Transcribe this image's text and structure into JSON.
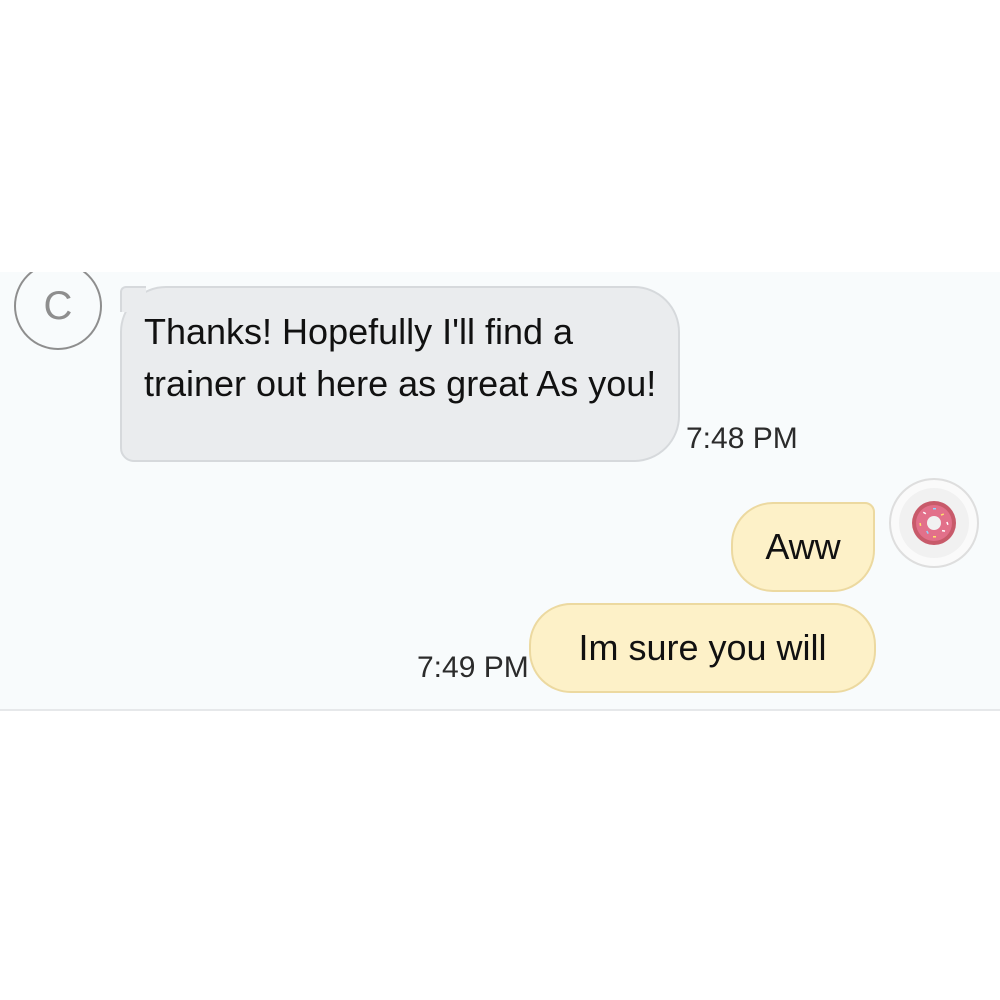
{
  "conversation": {
    "contact": {
      "initial": "C"
    },
    "messages": [
      {
        "direction": "incoming",
        "text": "Thanks! Hopefully I'll find a trainer out here as great As you!",
        "time": "7:48 PM"
      },
      {
        "direction": "outgoing",
        "text": "Aww"
      },
      {
        "direction": "outgoing",
        "text": "Im sure you will",
        "time": "7:49 PM"
      }
    ],
    "self_avatar": {
      "icon": "donut-icon"
    }
  },
  "colors": {
    "incoming_bubble": "#eaecee",
    "outgoing_bubble": "#fdf1c8",
    "panel_background": "#f8fbfc"
  }
}
